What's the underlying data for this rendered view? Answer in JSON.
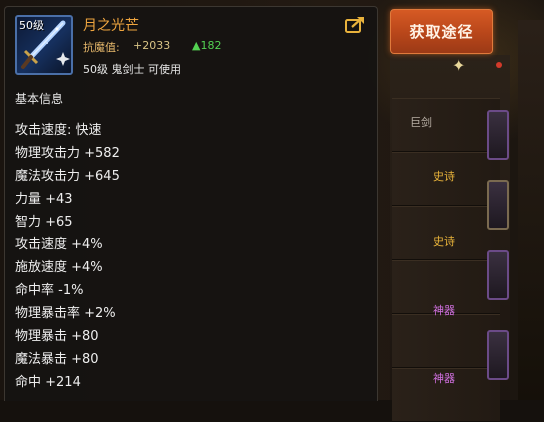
{
  "item": {
    "level_badge": "50级",
    "name": "月之光芒",
    "resist_label": "抗魔值:",
    "resist_value": "+2033",
    "resist_increase": "▲182",
    "requirement": "50级 鬼剑士 可使用",
    "icon": "sword-icon"
  },
  "share_icon": "share-icon",
  "get_source_button": "获取途径",
  "section_title": "基本信息",
  "stats": [
    "攻击速度: 快速",
    "物理攻击力 +582",
    "魔法攻击力 +645",
    "力量 +43",
    "智力 +65",
    "攻击速度 +4%",
    "施放速度 +4%",
    "命中率 -1%",
    "物理暴击率 +2%",
    "物理暴击 +80",
    "魔法暴击 +80",
    "命中 +214"
  ],
  "background": {
    "tags": [
      "巨剑",
      "史诗",
      "史诗",
      "神器",
      "神器"
    ]
  },
  "colors": {
    "item_name": "#efa53f",
    "resist_increase": "#53d252",
    "button": "#c84f1e",
    "panel": "#161412"
  }
}
